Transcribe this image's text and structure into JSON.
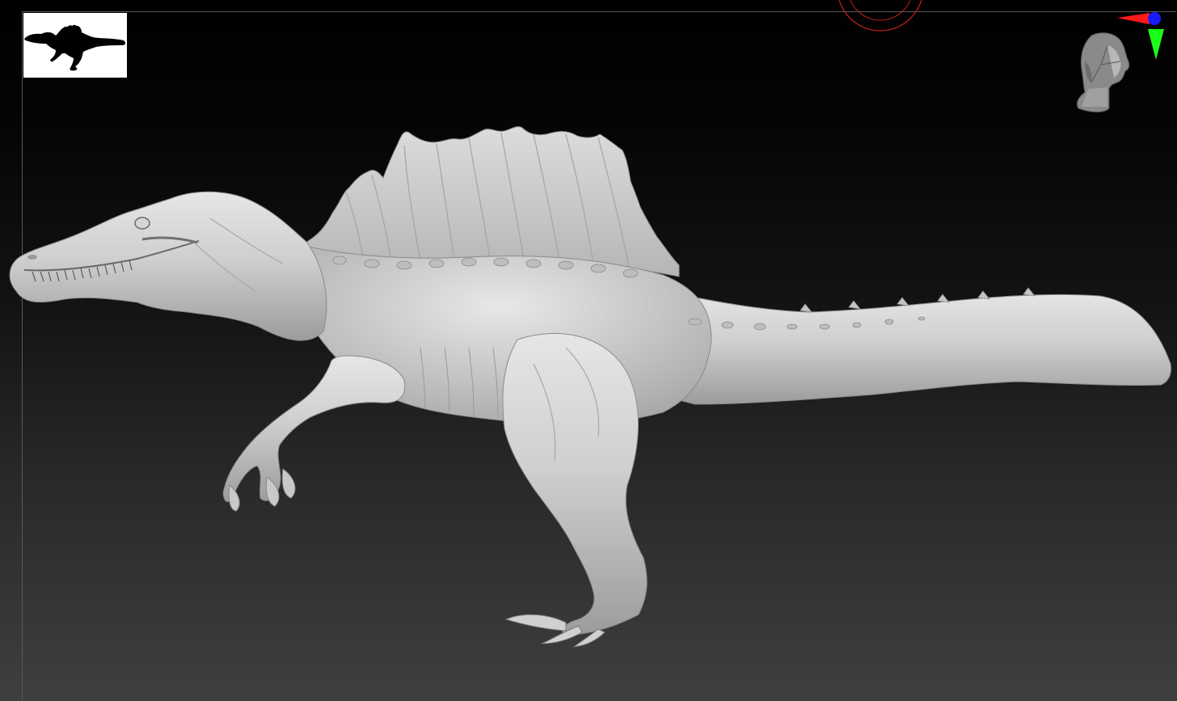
{
  "app": {
    "viewport": {
      "background": "dark-gradient",
      "model_color": "#c8c8c8"
    }
  },
  "thumbnail": {
    "icon": "spinosaurus-silhouette-icon",
    "background": "#ffffff",
    "silhouette_color": "#000000"
  },
  "model": {
    "icon": "spinosaurus-sculpt-model"
  },
  "navigation": {
    "orient_head_icon": "head-orientation-icon",
    "axis_gizmo_icon": "axis-gizmo-icon",
    "axis_colors": {
      "x": "#ff1a1a",
      "y": "#1aff1a",
      "z": "#1a1aff"
    }
  },
  "brush": {
    "icon": "brush-cursor-icon",
    "color": "#c81e1e"
  }
}
